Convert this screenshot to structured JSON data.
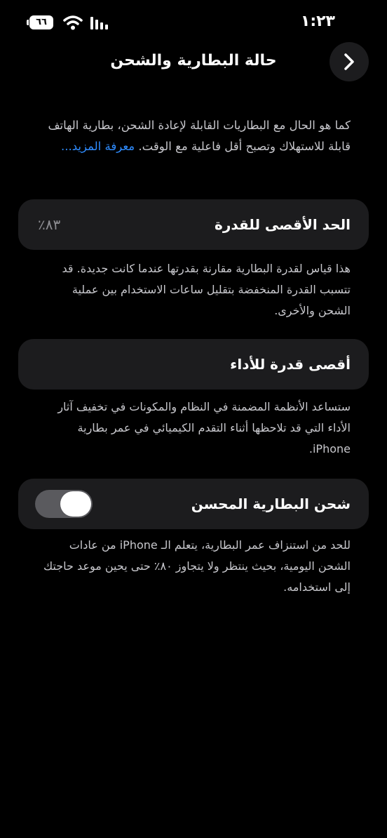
{
  "status_bar": {
    "time": "١:٢٣",
    "battery_level": "٦٦",
    "icons": [
      "battery-icon",
      "wifi-icon",
      "signal-icon"
    ]
  },
  "header": {
    "title": "حالة البطارية والشحن",
    "back_icon": "chevron-right-icon"
  },
  "intro": {
    "text": "كما هو الحال مع البطاريات القابلة لإعادة الشحن، بطارية الهاتف قابلة للاستهلاك وتصبح أقل فاعلية مع الوقت.",
    "link": "معرفة المزيد..."
  },
  "max_capacity": {
    "label": "الحد الأقصى للقدرة",
    "value": "٪٨٣",
    "description": "هذا قياس لقدرة البطارية مقارنة بقدرتها عندما كانت جديدة. قد تتسبب القدرة المنخفضة بتقليل ساعات الاستخدام بين عملية الشحن والأخرى."
  },
  "peak_performance": {
    "label": "أقصى قدرة للأداء",
    "description": "ستساعد الأنظمة المضمنة في النظام والمكونات في تخفيف آثار الأداء التي قد تلاحظها أثناء التقدم الكيميائي في عمر بطارية iPhone."
  },
  "optimized_charging": {
    "label": "شحن البطارية المحسن",
    "enabled": true,
    "description": "للحد من استنزاف عمر البطارية، يتعلم الـ iPhone من عادات الشحن اليومية، بحيث ينتظر ولا يتجاوز ٨٠٪ حتى يحين موعد حاجتك إلى استخدامه."
  }
}
